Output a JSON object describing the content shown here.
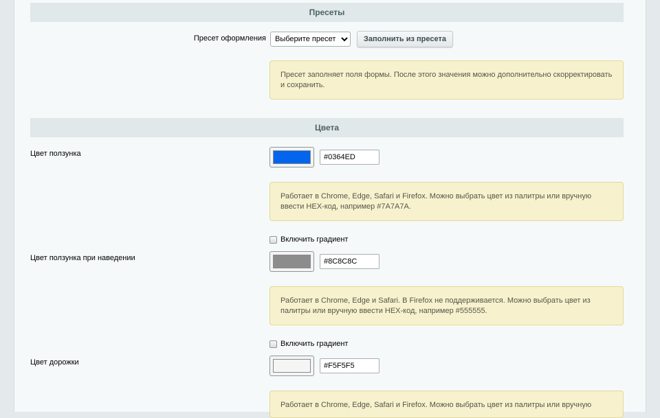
{
  "presets": {
    "section_title": "Пресеты",
    "preset_label": "Пресет оформления",
    "select_value": "Выберите пресет",
    "fill_button": "Заполнить из пресета",
    "note_line1": "Пресет заполняет поля формы. После этого значения можно дополнительно скорректировать",
    "note_line2": "и сохранить."
  },
  "colors": {
    "section_title": "Цвета",
    "thumb": {
      "label": "Цвет ползунка",
      "value": "#0364ED",
      "swatch": "#0364ED",
      "note_line1": "Работает в Chrome, Edge, Safari и Firefox. Можно выбрать цвет из палитры или вручную",
      "note_line2": "ввести HEX-код, например #7A7A7A.",
      "gradient_label": "Включить градиент"
    },
    "thumb_hover": {
      "label": "Цвет ползунка при наведении",
      "value": "#8C8C8C",
      "swatch": "#8C8C8C",
      "note_line1": "Работает в Chrome, Edge и Safari. В Firefox не поддерживается. Можно выбрать цвет из",
      "note_line2": "палитры или вручную ввести HEX-код, например #555555.",
      "gradient_label": "Включить градиент"
    },
    "track": {
      "label": "Цвет дорожки",
      "value": "#F5F5F5",
      "swatch": "#F5F5F5",
      "note_line1": "Работает в Chrome, Edge, Safari и Firefox. Можно выбрать цвет из палитры или вручную"
    }
  }
}
